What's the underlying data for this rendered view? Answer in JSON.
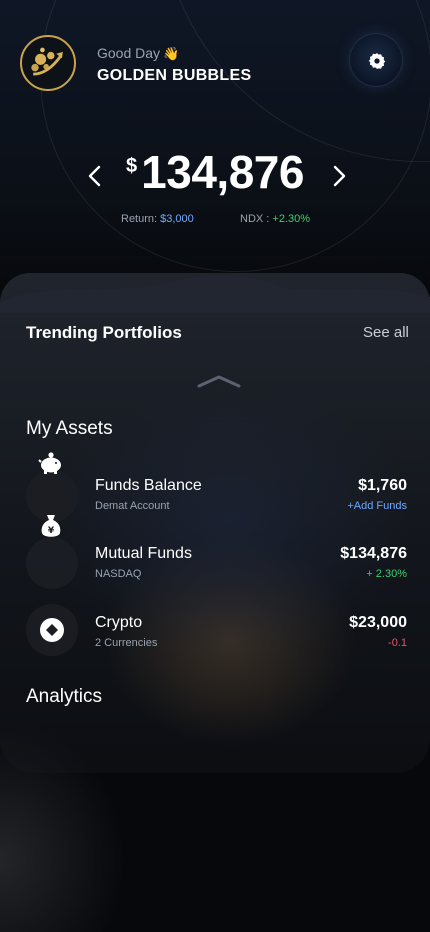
{
  "header": {
    "greeting": "Good Day",
    "greeting_emoji": "👋",
    "brand_name": "GOLDEN BUBBLES"
  },
  "balance": {
    "currency_symbol": "$",
    "amount": "134,876",
    "return_label": "Return:",
    "return_value": "$3,000",
    "index_label": "NDX :",
    "index_change": "+2.30%"
  },
  "trending": {
    "title": "Trending Portfolios",
    "see_all": "See all"
  },
  "assets": {
    "title": "My Assets",
    "items": [
      {
        "name": "Funds Balance",
        "subtitle": "Demat Account",
        "value": "$1,760",
        "detail": "+Add Funds",
        "detail_color": "#6fa8ff",
        "icon": "piggy-bank-icon"
      },
      {
        "name": "Mutual Funds",
        "subtitle": "NASDAQ",
        "value": "$134,876",
        "detail": "+ 2.30%",
        "detail_color": "#3fcf6b",
        "icon": "money-bag-icon"
      },
      {
        "name": "Crypto",
        "subtitle": "2 Currencies",
        "value": "$23,000",
        "detail": "-0.1",
        "detail_color": "#e05a66",
        "icon": "crypto-icon"
      }
    ]
  },
  "analytics": {
    "title": "Analytics"
  },
  "colors": {
    "accent_gold": "#c9a34a",
    "positive": "#3fcf6b",
    "negative": "#e05a66",
    "link": "#6fa8ff"
  }
}
